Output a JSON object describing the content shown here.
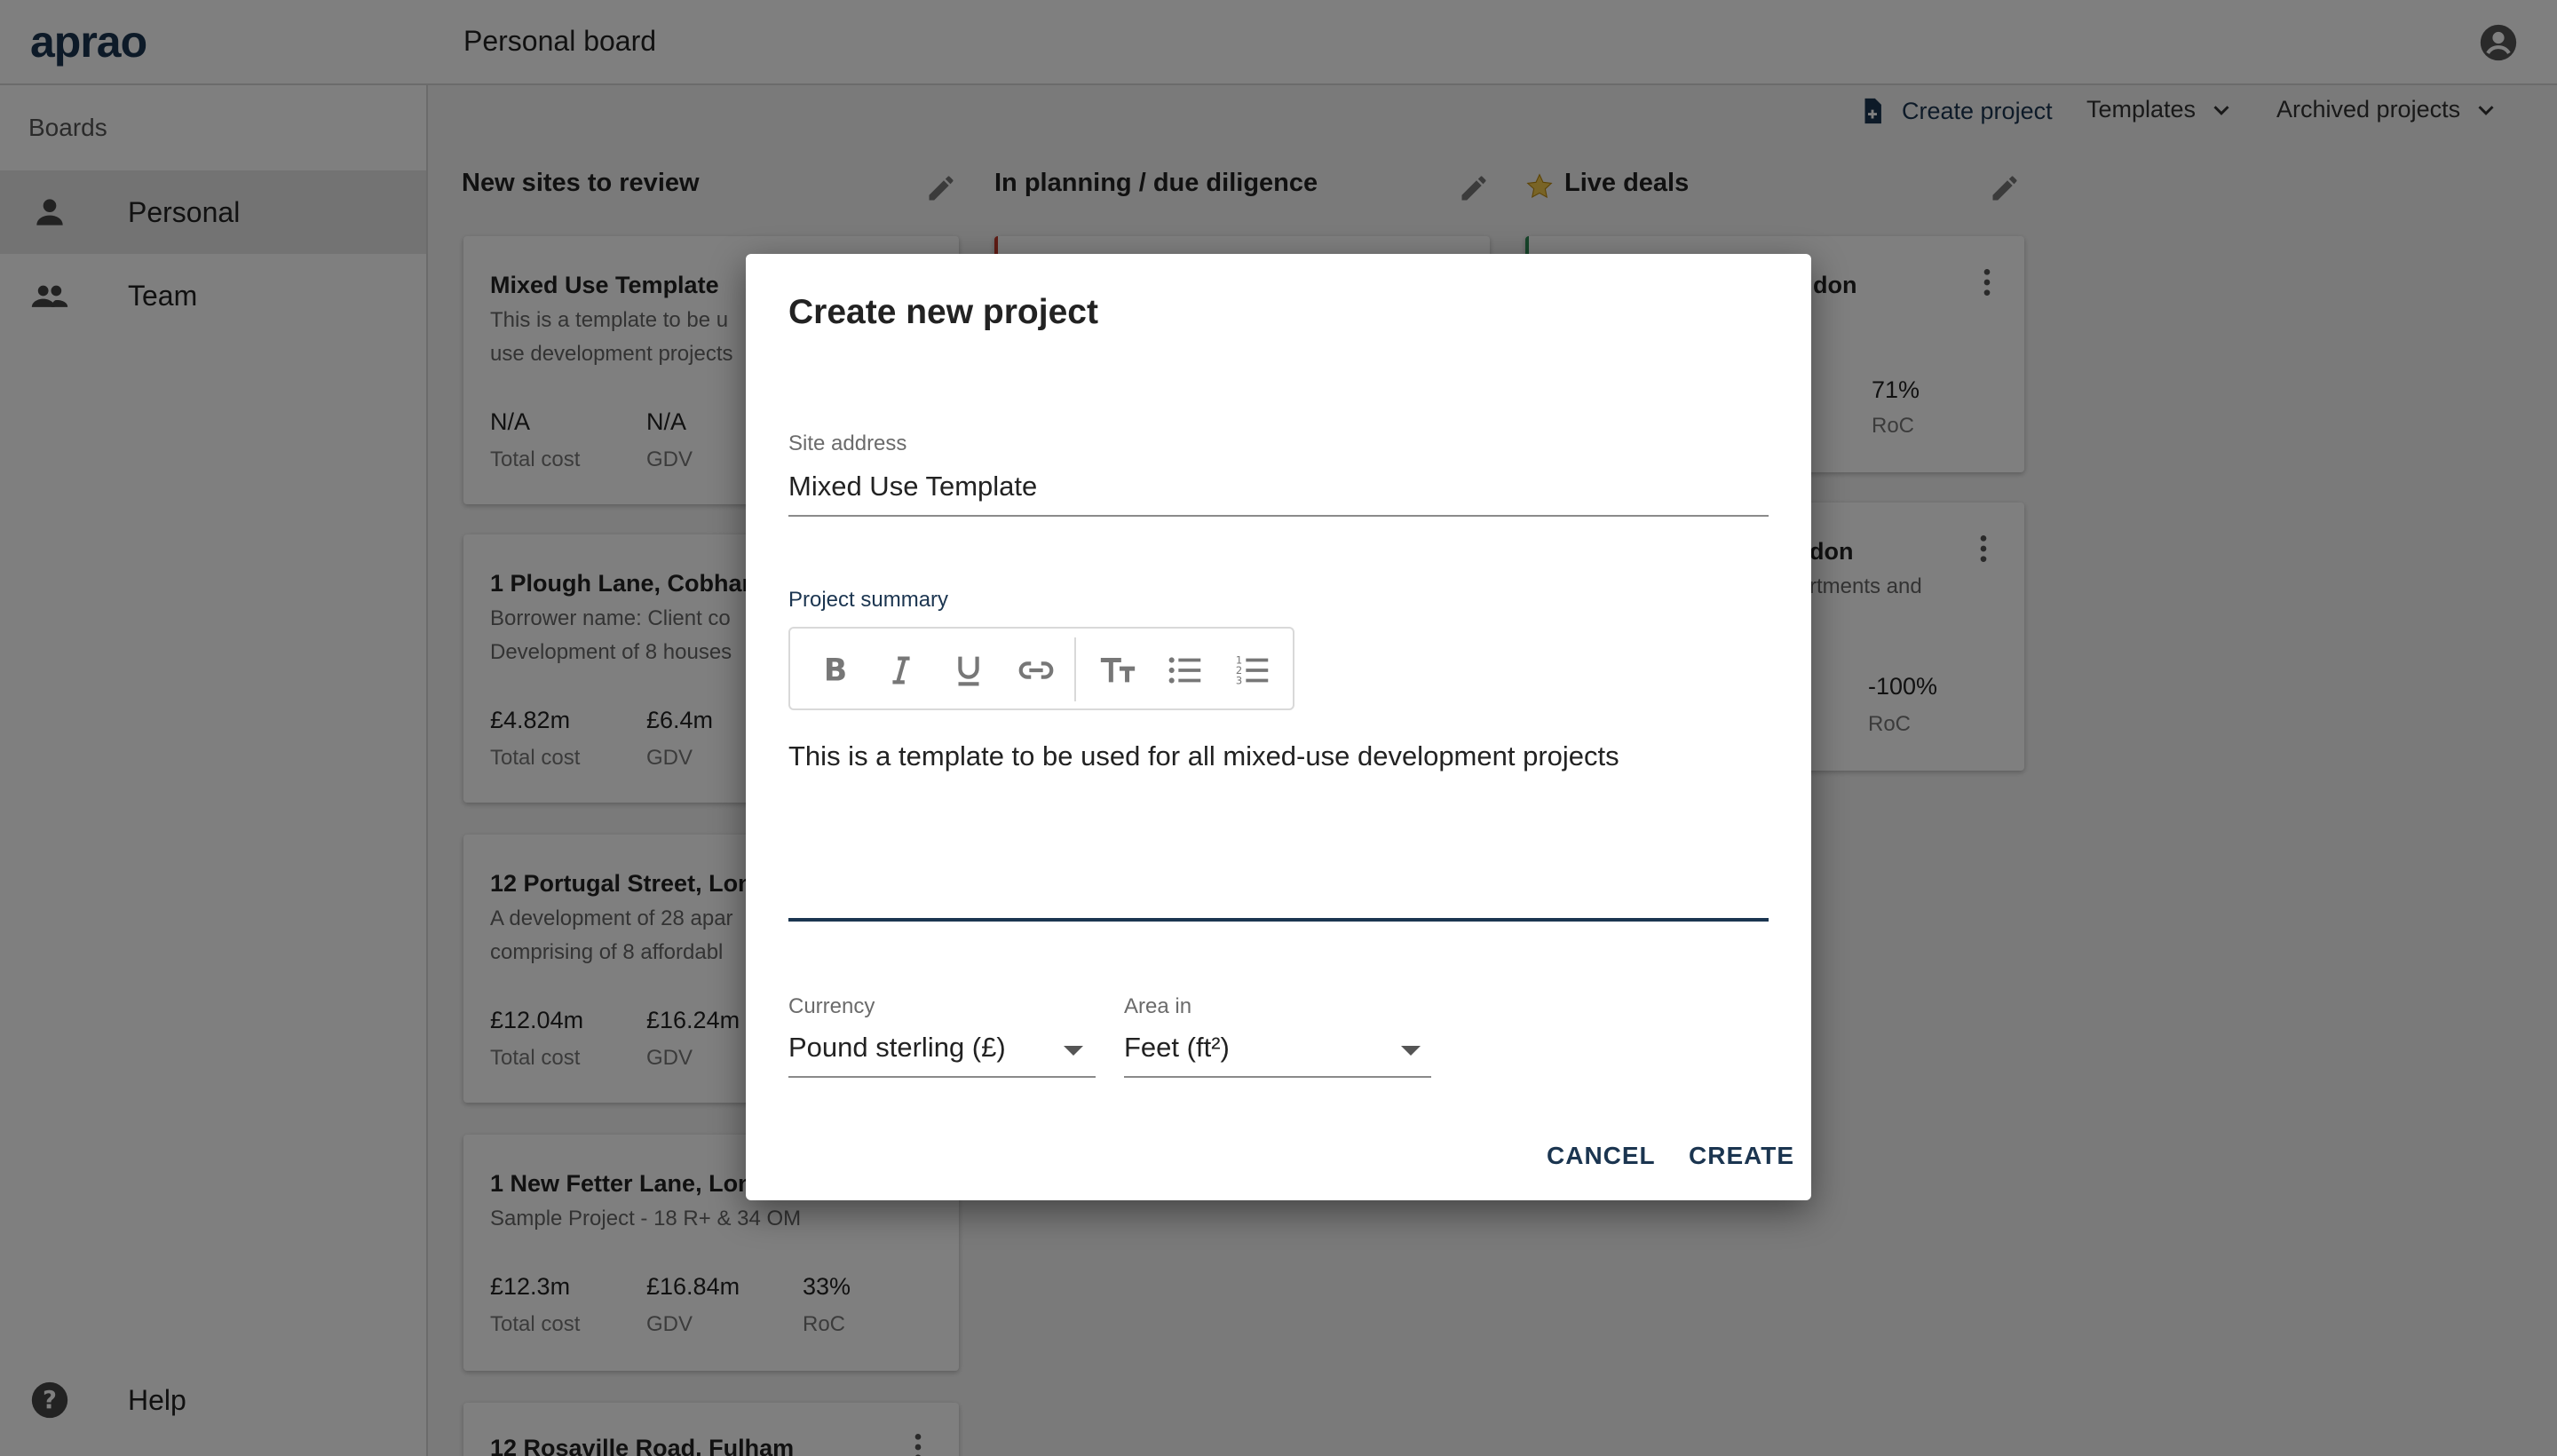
{
  "header": {
    "logo": "aprao",
    "title": "Personal board"
  },
  "sidebar": {
    "heading": "Boards",
    "items": [
      {
        "label": "Personal",
        "icon": "person-icon",
        "active": true
      },
      {
        "label": "Team",
        "icon": "group-icon",
        "active": false
      }
    ],
    "help_label": "Help"
  },
  "actions": {
    "create_project": "Create project",
    "templates": "Templates",
    "archived": "Archived projects"
  },
  "columns": [
    {
      "title": "New sites to review"
    },
    {
      "title": "In planning / due diligence"
    },
    {
      "title": "Live deals",
      "star": true
    }
  ],
  "cards_col1": [
    {
      "title": "Mixed Use Template",
      "desc1": "This is a template to be u",
      "desc2": "use development projects",
      "m1": "N/A",
      "m1l": "Total cost",
      "m2": "N/A",
      "m2l": "GDV"
    },
    {
      "title": "1 Plough Lane, Cobham",
      "desc1": "Borrower name: Client co",
      "desc2": "Development of 8 houses",
      "m1": "£4.82m",
      "m1l": "Total cost",
      "m2": "£6.4m",
      "m2l": "GDV"
    },
    {
      "title": "12 Portugal Street, Lon",
      "desc1": "A development of 28 apar",
      "desc2": "comprising of 8 affordabl",
      "m1": "£12.04m",
      "m1l": "Total cost",
      "m2": "£16.24m",
      "m2l": "GDV"
    },
    {
      "title": "1 New Fetter Lane, Lon",
      "desc1": "Sample Project - 18 R+ & 34 OM",
      "desc2": "",
      "m1": "£12.3m",
      "m1l": "Total cost",
      "m2": "£16.84m",
      "m2l": "GDV",
      "m3": "33%",
      "m3l": "RoC"
    },
    {
      "title": "12 Rosaville Road, Fulham"
    }
  ],
  "cards_col3": [
    {
      "title": "don",
      "m3": "71%",
      "m3l": "RoC"
    },
    {
      "title": "don",
      "desc1": "rtments and",
      "m3": "-100%",
      "m3l": "RoC"
    }
  ],
  "dialog": {
    "title": "Create new project",
    "site_address_label": "Site address",
    "site_address_value": "Mixed Use Template",
    "summary_label": "Project summary",
    "summary_text": "This is a template to be used for all mixed-use development projects",
    "currency_label": "Currency",
    "currency_value": "Pound sterling (£)",
    "area_label": "Area in",
    "area_value": "Feet (ft²)",
    "cancel": "CANCEL",
    "create": "CREATE"
  },
  "colors": {
    "brand": "#1b3550",
    "scrim": "rgba(0,0,0,0.5)"
  }
}
